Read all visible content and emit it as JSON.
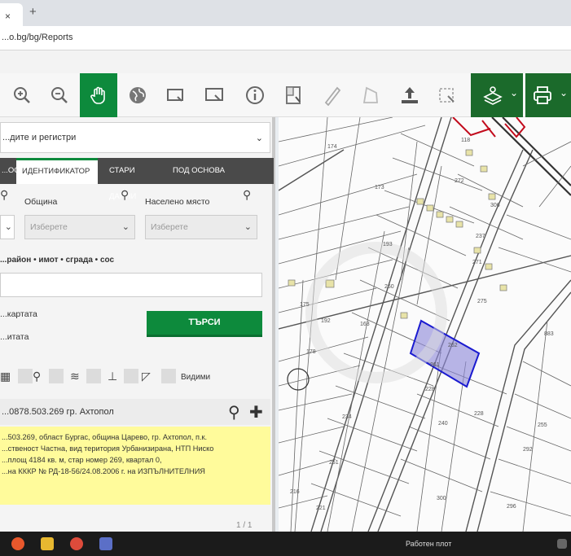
{
  "browser": {
    "tab_close": "×",
    "new_tab": "+",
    "address": "...o.bg/bg/Reports"
  },
  "toolbar": {
    "tools": [
      "zoom-in",
      "zoom-out",
      "pan-hand",
      "globe",
      "rectangle-select",
      "screen-select",
      "info",
      "building-select",
      "ruler",
      "area-measure",
      "upload",
      "select-clear",
      "layers",
      "print"
    ],
    "accent_color": "#0d8a3c"
  },
  "panel": {
    "register_select": "...дите и регистри",
    "tabs": [
      "...ОС",
      "ИДЕНТИФИКАТОР",
      "СТАРИ ДАННИ",
      "ПОД ОСНОВА"
    ],
    "municipality_label": "Община",
    "settlement_label": "Населено място",
    "municipality_value": "Изберете",
    "settlement_value": "Изберете",
    "search_hint": "...район • имот • сграда • сос",
    "radio_1": "...картата",
    "radio_2": "...итата",
    "search_button": "ТЪРСИ",
    "visible_label": "Видими",
    "result_title": "...0878.503.269 гр. Ахтопол",
    "result_lines": [
      "...503.269, област Бургас, община Царево, гр. Ахтопол, п.к.",
      "...ственост Частна, вид територия Урбанизирана, НТП Ниско",
      "...площ 4184 кв. м, стар номер 269, квартал 0,",
      "...на КККР № РД-18-56/24.08.2006 г. на ИЗПЪЛНИТЕЛНИЯ"
    ],
    "pager": "1 / 1"
  },
  "taskbar": {
    "language": "Работен плот"
  }
}
